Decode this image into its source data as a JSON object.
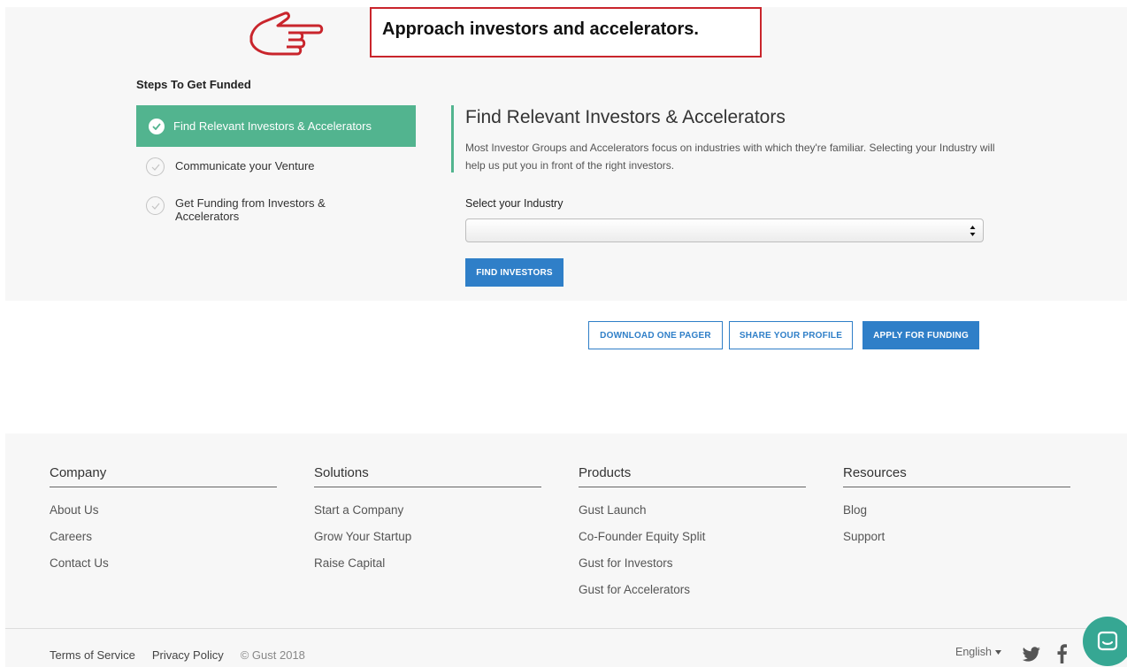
{
  "callout": {
    "text": "Approach investors and accelerators.",
    "icon": "pointing-hand-icon",
    "color": "#c9252c"
  },
  "steps": {
    "title": "Steps To Get Funded",
    "items": [
      {
        "label": "Find Relevant Investors & Accelerators",
        "active": true
      },
      {
        "label": "Communicate your Venture",
        "active": false
      },
      {
        "label": "Get Funding from Investors & Accelerators",
        "active": false
      }
    ],
    "active_color": "#52b48f"
  },
  "content": {
    "title": "Find Relevant Investors & Accelerators",
    "description": "Most Investor Groups and Accelerators focus on industries with which they're familiar. Selecting your Industry will help us put you in front of the right investors.",
    "industry_label": "Select your Industry",
    "industry_value": "",
    "find_button": "FIND INVESTORS"
  },
  "actions": {
    "download": "DOWNLOAD ONE PAGER",
    "share": "SHARE YOUR PROFILE",
    "apply": "APPLY FOR FUNDING",
    "primary_color": "#2f7fc8"
  },
  "footer": {
    "columns": [
      {
        "title": "Company",
        "links": [
          "About Us",
          "Careers",
          "Contact Us"
        ]
      },
      {
        "title": "Solutions",
        "links": [
          "Start a Company",
          "Grow Your Startup",
          "Raise Capital"
        ]
      },
      {
        "title": "Products",
        "links": [
          "Gust Launch",
          "Co-Founder Equity Split",
          "Gust for Investors",
          "Gust for Accelerators"
        ]
      },
      {
        "title": "Resources",
        "links": [
          "Blog",
          "Support"
        ]
      }
    ],
    "terms": "Terms of Service",
    "privacy": "Privacy Policy",
    "copyright": "© Gust 2018",
    "language": "English"
  },
  "chat": {
    "icon": "chat-icon",
    "color": "#36a793"
  }
}
